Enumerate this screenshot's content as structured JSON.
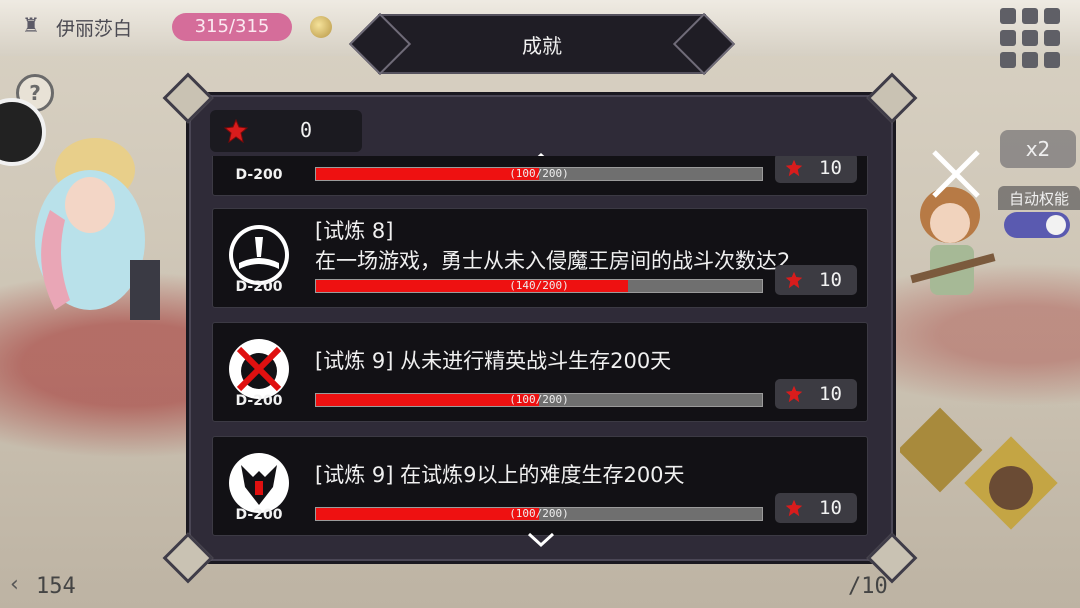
{
  "top": {
    "player_name": "伊丽莎白",
    "hp": "315/315"
  },
  "dialog": {
    "title": "成就",
    "gem_count": "0"
  },
  "achievements": [
    {
      "title": "",
      "description": "",
      "badge": "D-200",
      "progress_text": "(100/200)",
      "progress": 0.5,
      "reward": "10",
      "icon": "achievement-emblem-icon"
    },
    {
      "title": "[试炼 8]",
      "description": "在一场游戏，勇士从未入侵魔王房间的战斗次数达2",
      "badge": "D-200",
      "progress_text": "(140/200)",
      "progress": 0.7,
      "reward": "10",
      "icon": "book-emblem-icon"
    },
    {
      "title": "[试炼 9] 从未进行精英战斗生存200天",
      "description": "",
      "badge": "D-200",
      "progress_text": "(100/200)",
      "progress": 0.5,
      "reward": "10",
      "icon": "crossed-elite-emblem-icon"
    },
    {
      "title": "[试炼 9] 在试炼9以上的难度生存200天",
      "description": "",
      "badge": "D-200",
      "progress_text": "(100/200)",
      "progress": 0.5,
      "reward": "10",
      "icon": "demon-mask-emblem-icon"
    }
  ],
  "side": {
    "speed": "x2",
    "auto_label": "自动权能"
  },
  "bottom": {
    "left_count": "154",
    "right_count": "/10"
  },
  "colors": {
    "progress": "#ee1111",
    "hp": "#d56d9a",
    "gem": "#d81c1c",
    "toggle": "#5a5ab0"
  }
}
